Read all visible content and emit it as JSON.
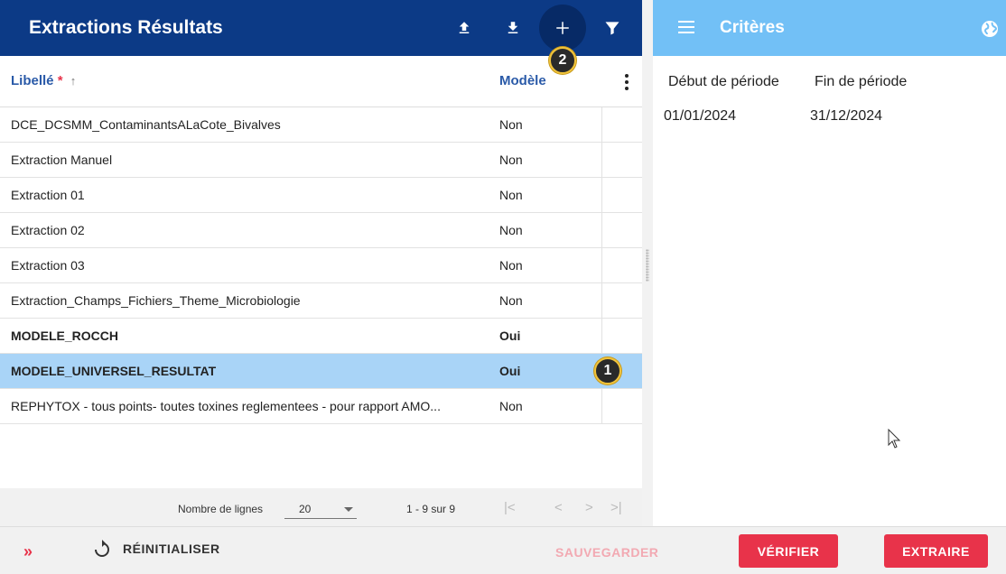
{
  "left_panel": {
    "title": "Extractions Résultats",
    "toolbar": {
      "upload_icon": "upload-icon",
      "download_icon": "download-icon",
      "add_icon": "add-icon",
      "filter_icon": "filter-icon"
    },
    "badges": {
      "badge_1": "1",
      "badge_2": "2"
    },
    "columns": {
      "label": "Libellé",
      "required_mark": "*",
      "sort_arrow": "↑",
      "model": "Modèle"
    },
    "rows": [
      {
        "label": "DCE_DCSMM_ContaminantsALaCote_Bivalves",
        "model": "Non"
      },
      {
        "label": "Extraction Manuel",
        "model": "Non"
      },
      {
        "label": "Extraction 01",
        "model": "Non"
      },
      {
        "label": "Extraction 02",
        "model": "Non"
      },
      {
        "label": "Extraction 03",
        "model": "Non"
      },
      {
        "label": "Extraction_Champs_Fichiers_Theme_Microbiologie",
        "model": "Non"
      },
      {
        "label": "MODELE_ROCCH",
        "model": "Oui"
      },
      {
        "label": "MODELE_UNIVERSEL_RESULTAT",
        "model": "Oui"
      },
      {
        "label": "REPHYTOX - tous points- toutes toxines reglementees - pour rapport AMO...",
        "model": "Non"
      }
    ],
    "footer": {
      "rows_label": "Nombre de lignes",
      "rows_value": "20",
      "range": "1 - 9 sur 9",
      "first": "|<",
      "prev": "<",
      "next": ">",
      "last": ">|"
    }
  },
  "right_panel": {
    "title": "Critères",
    "start_label": "Début de période",
    "end_label": "Fin de période",
    "start_value": "01/01/2024",
    "end_value": "31/12/2024"
  },
  "bottom_bar": {
    "expand": "»",
    "reset": "RÉINITIALISER",
    "save": "SAUVEGARDER",
    "verify": "VÉRIFIER",
    "extract": "EXTRAIRE"
  },
  "colors": {
    "primary_dark": "#0c3a86",
    "primary_light": "#72c0f6",
    "accent": "#e8334a",
    "selected_row": "#a9d4f7"
  }
}
